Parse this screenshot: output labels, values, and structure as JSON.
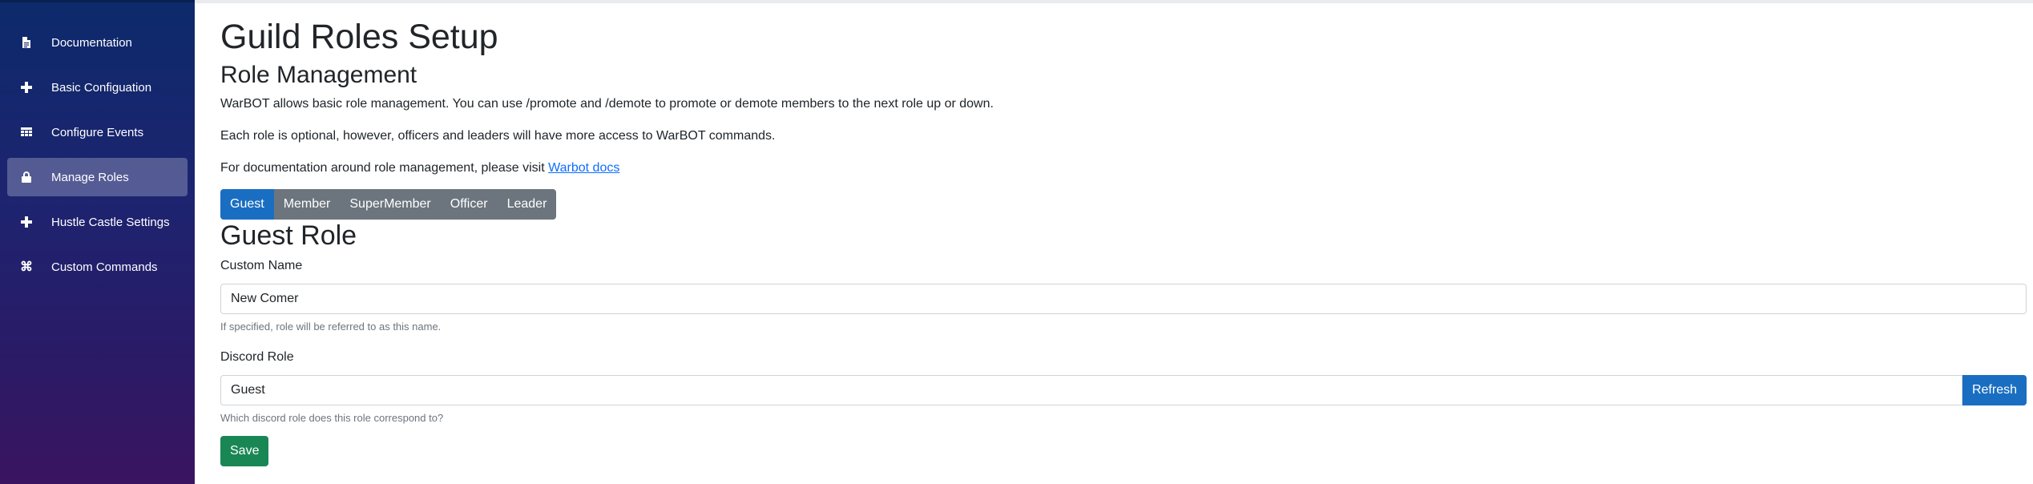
{
  "sidebar": {
    "items": [
      {
        "label": "Documentation",
        "icon": "document-icon",
        "active": false
      },
      {
        "label": "Basic Configuation",
        "icon": "plus-icon",
        "active": false
      },
      {
        "label": "Configure Events",
        "icon": "calendar-icon",
        "active": false
      },
      {
        "label": "Manage Roles",
        "icon": "lock-icon",
        "active": true
      },
      {
        "label": "Hustle Castle Settings",
        "icon": "plus-icon",
        "active": false
      },
      {
        "label": "Custom Commands",
        "icon": "command-icon",
        "active": false
      }
    ]
  },
  "main": {
    "title": "Guild Roles Setup",
    "section_title": "Role Management",
    "intro": "WarBOT allows basic role management. You can use /promote and /demote to promote or demote members to the next role up or down.",
    "optional_note": "Each role is optional, however, officers and leaders will have more access to WarBOT commands.",
    "docs_prefix": "For documentation around role management, please visit ",
    "docs_link": "Warbot docs",
    "tabs": [
      {
        "label": "Guest",
        "active": true
      },
      {
        "label": "Member",
        "active": false
      },
      {
        "label": "SuperMember",
        "active": false
      },
      {
        "label": "Officer",
        "active": false
      },
      {
        "label": "Leader",
        "active": false
      }
    ],
    "role_title": "Guest Role",
    "custom_name": {
      "label": "Custom Name",
      "value": "New Comer",
      "help": "If specified, role will be referred to as this name."
    },
    "discord_role": {
      "label": "Discord Role",
      "value": "Guest",
      "help": "Which discord role does this role correspond to?",
      "refresh_label": "Refresh"
    },
    "save_label": "Save"
  },
  "colors": {
    "primary": "#1a6ec2",
    "secondary": "#6c757d",
    "success": "#198754",
    "sidebar_top": "#0d2a6b",
    "sidebar_bottom": "#3a1460"
  }
}
